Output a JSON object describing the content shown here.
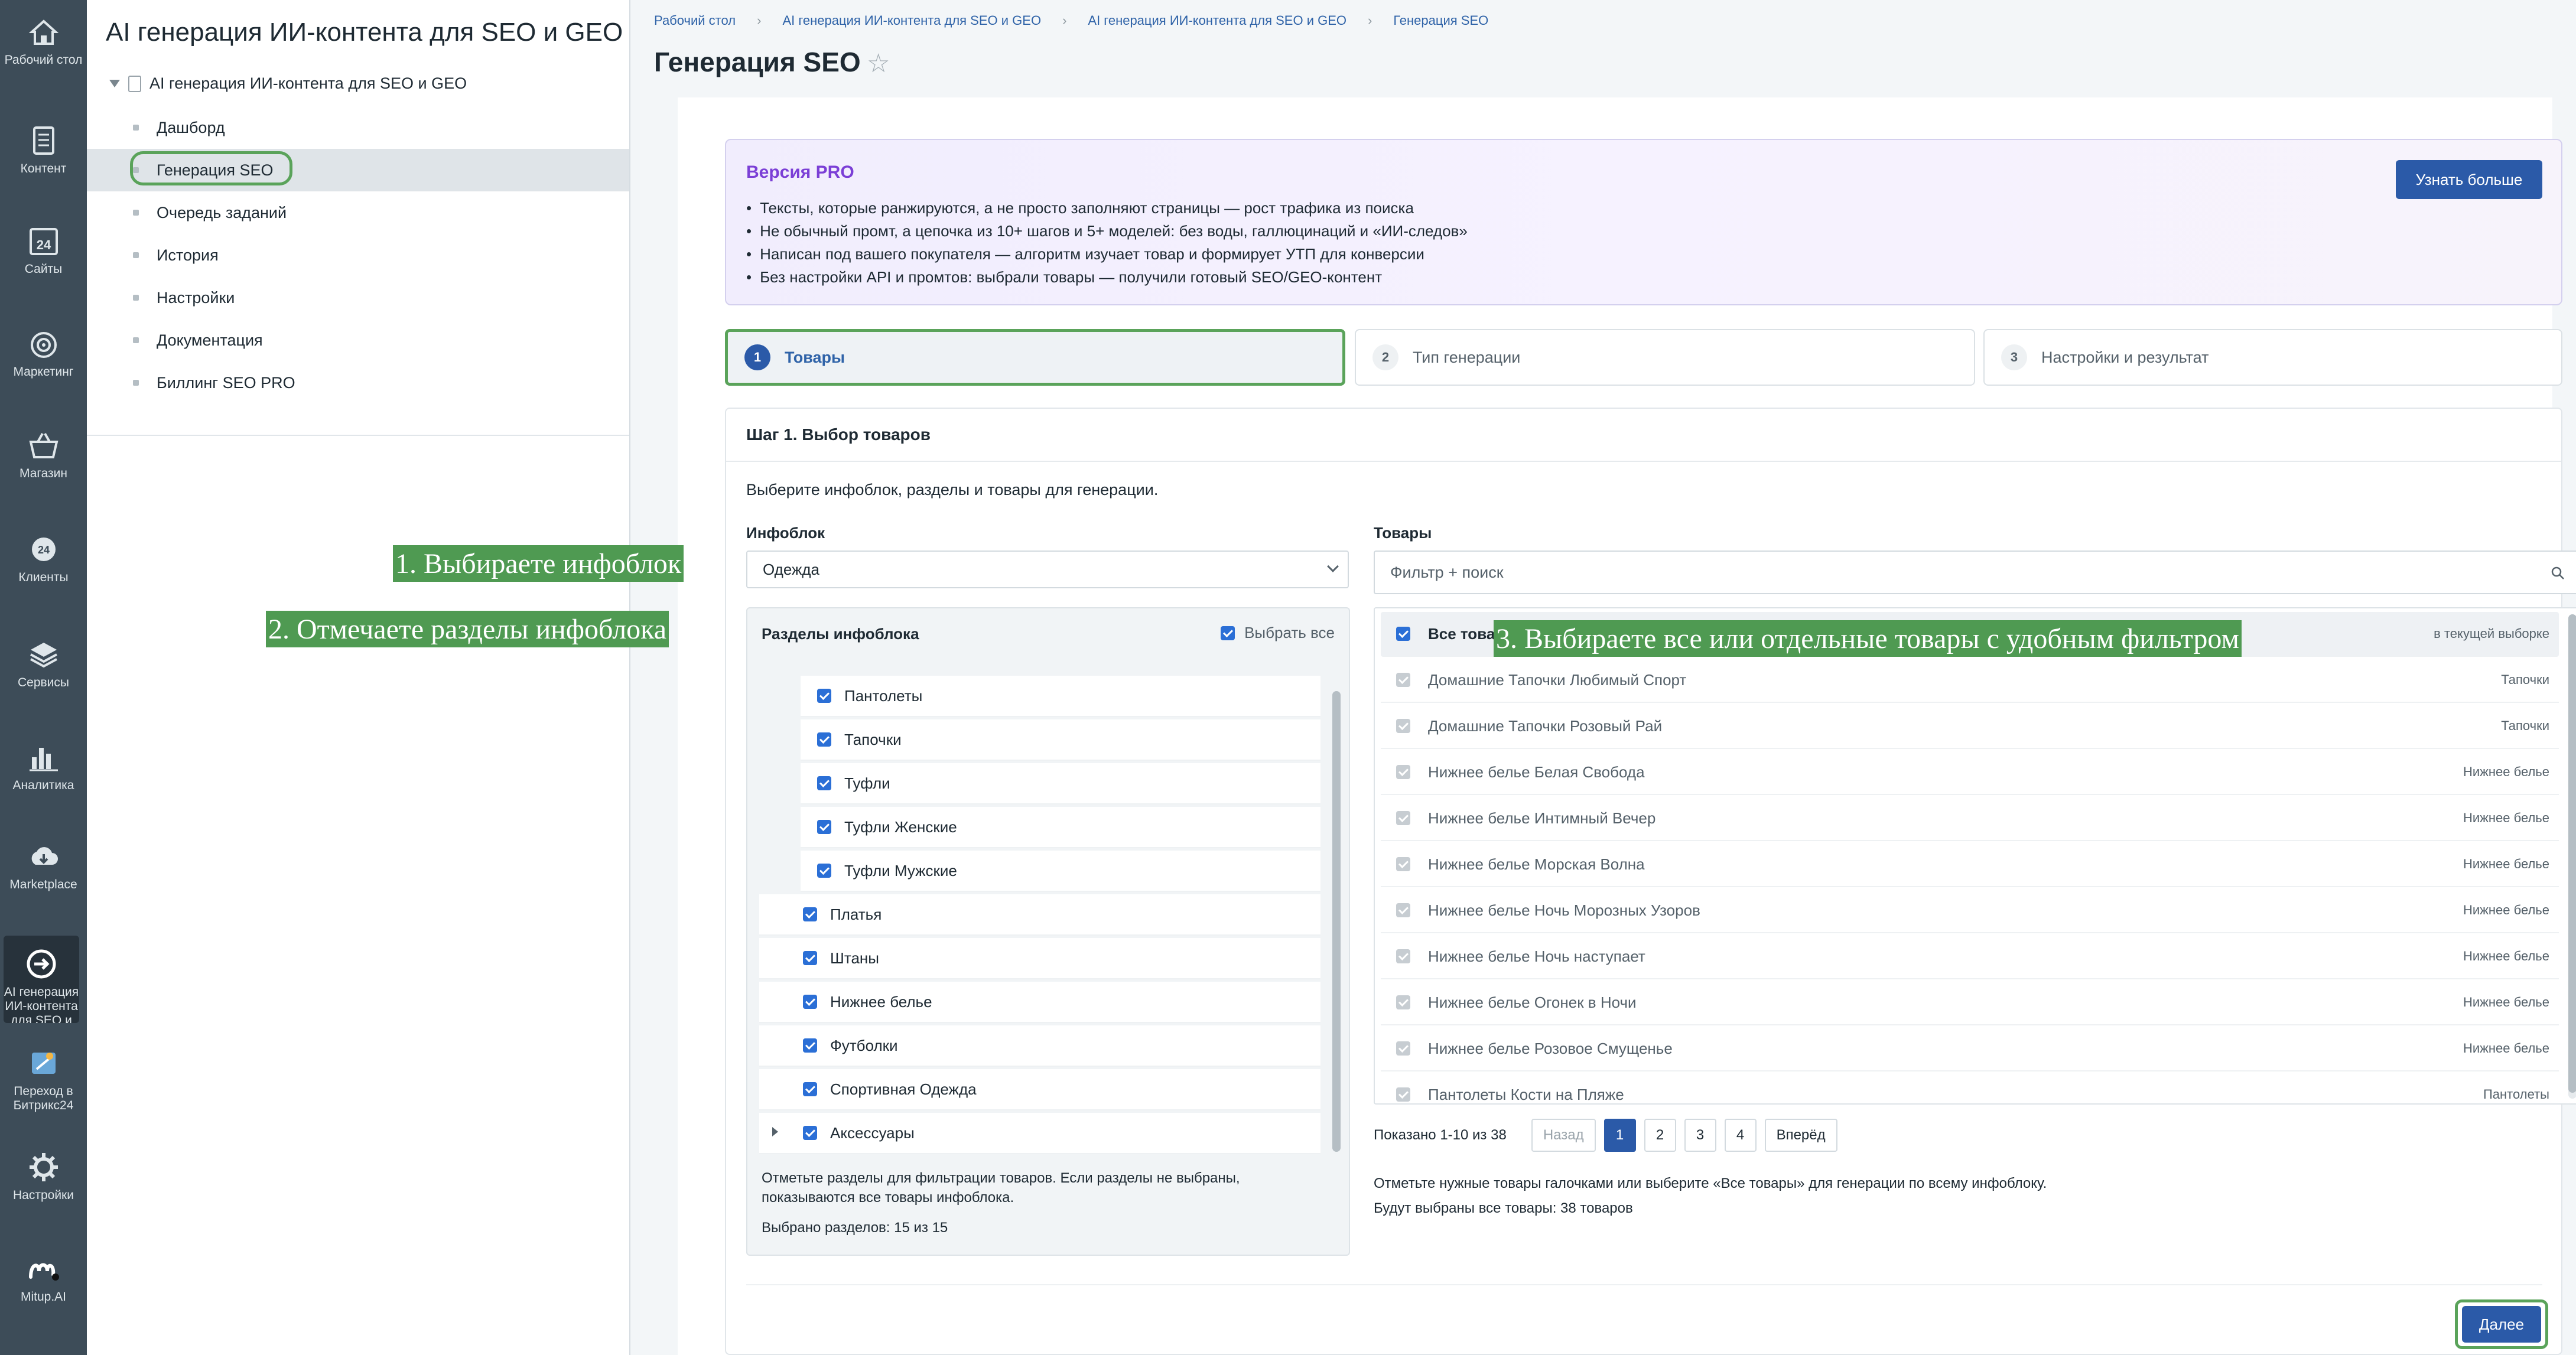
{
  "rail": {
    "items": [
      {
        "label": "Рабочий стол",
        "icon": "home-icon"
      },
      {
        "label": "Контент",
        "icon": "document-icon"
      },
      {
        "label": "Сайты",
        "icon": "calendar-24-icon"
      },
      {
        "label": "Маркетинг",
        "icon": "target-icon"
      },
      {
        "label": "Магазин",
        "icon": "basket-icon"
      },
      {
        "label": "Клиенты",
        "icon": "crm-24-icon"
      },
      {
        "label": "Сервисы",
        "icon": "layers-icon"
      },
      {
        "label": "Аналитика",
        "icon": "bar-chart-icon"
      },
      {
        "label": "Marketplace",
        "icon": "cloud-download-icon"
      },
      {
        "label": "AI генерация ИИ-контента для SEO и",
        "icon": "arrow-circle-icon",
        "active": true
      },
      {
        "label": "Переход в Битрикс24",
        "icon": "bitrix-tile-icon"
      },
      {
        "label": "Настройки",
        "icon": "gear-icon"
      },
      {
        "label": "Mitup.AI",
        "icon": "mitup-logo-icon"
      }
    ]
  },
  "menu": {
    "title": "AI генерация ИИ-контента для SEO и GEO",
    "root": "AI генерация ИИ-контента для SEO и GEO",
    "items": [
      {
        "label": "Дашборд"
      },
      {
        "label": "Генерация SEO",
        "active": true
      },
      {
        "label": "Очередь заданий"
      },
      {
        "label": "История"
      },
      {
        "label": "Настройки"
      },
      {
        "label": "Документация"
      },
      {
        "label": "Биллинг SEO PRO"
      }
    ]
  },
  "breadcrumbs": [
    "Рабочий стол",
    "AI генерация ИИ-контента для SEO и GEO",
    "AI генерация ИИ-контента для SEO и GEO",
    "Генерация SEO"
  ],
  "page": {
    "title": "Генерация SEO"
  },
  "pro": {
    "title": "Версия PRO",
    "bullets": [
      "Тексты, которые ранжируются, а не просто заполняют страницы — рост трафика из поиска",
      "Не обычный промт, а цепочка из 10+ шагов и 5+ моделей: без воды, галлюцинаций и «ИИ-следов»",
      "Написан под вашего покупателя — алгоритм изучает товар и формирует УТП для конверсии",
      "Без настройки API и промтов: выбрали товары — получили готовый SEO/GEO-контент"
    ],
    "button": "Узнать больше"
  },
  "steps": [
    {
      "num": "1",
      "label": "Товары",
      "active": true
    },
    {
      "num": "2",
      "label": "Тип генерации"
    },
    {
      "num": "3",
      "label": "Настройки и результат"
    }
  ],
  "step1": {
    "title": "Шаг 1. Выбор товаров",
    "subtitle": "Выберите инфоблок, разделы и товары для генерации.",
    "infoblock_label": "Инфоблок",
    "infoblock_value": "Одежда",
    "sections_label": "Разделы инфоблока",
    "select_all": "Выбрать все",
    "sections": [
      {
        "label": "Пантолеты",
        "level": 2,
        "checked": true
      },
      {
        "label": "Тапочки",
        "level": 2,
        "checked": true
      },
      {
        "label": "Туфли",
        "level": 2,
        "checked": true
      },
      {
        "label": "Туфли Женские",
        "level": 2,
        "checked": true
      },
      {
        "label": "Туфли Мужские",
        "level": 2,
        "checked": true
      },
      {
        "label": "Платья",
        "level": 1,
        "checked": true
      },
      {
        "label": "Штаны",
        "level": 1,
        "checked": true
      },
      {
        "label": "Нижнее белье",
        "level": 1,
        "checked": true
      },
      {
        "label": "Футболки",
        "level": 1,
        "checked": true
      },
      {
        "label": "Спортивная Одежда",
        "level": 1,
        "checked": true
      },
      {
        "label": "Аксессуары",
        "level": 1,
        "checked": true,
        "expandable": true
      }
    ],
    "sections_note": "Отметьте разделы для фильтрации товаров. Если разделы не выбраны, показываются все товары инфоблока.",
    "sections_count": "Выбрано разделов: 15 из 15",
    "products_label": "Товары",
    "search_placeholder": "Фильтр + поиск",
    "all_products": {
      "label": "Все товары",
      "hint": "в текущей выборке"
    },
    "products": [
      {
        "name": "Домашние Тапочки Любимый Спорт",
        "category": "Тапочки"
      },
      {
        "name": "Домашние Тапочки Розовый Рай",
        "category": "Тапочки"
      },
      {
        "name": "Нижнее белье Белая Свобода",
        "category": "Нижнее белье"
      },
      {
        "name": "Нижнее белье Интимный Вечер",
        "category": "Нижнее белье"
      },
      {
        "name": "Нижнее белье Морская Волна",
        "category": "Нижнее белье"
      },
      {
        "name": "Нижнее белье Ночь Морозных Узоров",
        "category": "Нижнее белье"
      },
      {
        "name": "Нижнее белье Ночь наступает",
        "category": "Нижнее белье"
      },
      {
        "name": "Нижнее белье Огонек в Ночи",
        "category": "Нижнее белье"
      },
      {
        "name": "Нижнее белье Розовое Смущенье",
        "category": "Нижнее белье"
      },
      {
        "name": "Пантолеты Кости на Пляже",
        "category": "Пантолеты"
      }
    ],
    "pager": {
      "shown": "Показано 1-10 из 38",
      "prev": "Назад",
      "pages": [
        "1",
        "2",
        "3",
        "4"
      ],
      "current": "1",
      "next": "Вперёд"
    },
    "hint1": "Отметьте нужные товары галочками или выберите «Все товары» для генерации по всему инфоблоку.",
    "hint2": "Будут выбраны все товары: 38 товаров",
    "next_button": "Далее"
  },
  "annotations": {
    "a1": "1. Выбираете инфоблок",
    "a2": "2. Отмечаете разделы инфоблока",
    "a3": "3. Выбираете все или отдельные товары с удобным фильтром"
  },
  "colors": {
    "accent": "#2b5aa8",
    "highlight": "#5aa35a",
    "pro_title": "#7b3fd6",
    "rail": "#3d4c58"
  }
}
